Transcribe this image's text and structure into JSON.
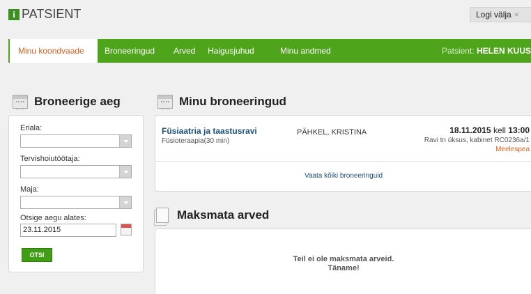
{
  "header": {
    "logo_letter": "i",
    "logo_text": "PATSIENT",
    "logout_label": "Logi välja",
    "logout_close": "×"
  },
  "nav": {
    "items": [
      {
        "label": "Minu koondvaade",
        "active": true
      },
      {
        "label": "Broneeringud"
      },
      {
        "label": "Arved"
      },
      {
        "label": "Haigusjuhud"
      },
      {
        "label": "Minu andmed"
      }
    ],
    "patient_prefix": "Patsient:",
    "patient_name": "HELEN KUUS"
  },
  "search_panel": {
    "title": "Broneerige aeg",
    "specialty_label": "Eriala:",
    "specialty_value": "",
    "worker_label": "Tervishoiutöötaja:",
    "worker_value": "",
    "building_label": "Maja:",
    "building_value": "",
    "from_label": "Otsige aegu alates:",
    "from_value": "23.11.2015",
    "button_label": "OTSI"
  },
  "bookings": {
    "title": "Minu broneeringud",
    "items": [
      {
        "service": "Füsiaatria ja taastusravi",
        "detail": "Füsioteraapia(30 min)",
        "doctor": "PÄHKEL, KRISTINA",
        "date": "18.11.2015",
        "time_label": "kell",
        "time": "13:00",
        "location": "Ravi tn üksus, kabinet RC0236a/1",
        "reminder": "Meelespea"
      }
    ],
    "view_all_label": "Vaata kõiki broneeringuid"
  },
  "invoices": {
    "title": "Maksmata arved",
    "empty_line1": "Teil ei ole maksmata arveid.",
    "empty_line2": "Täname!"
  }
}
